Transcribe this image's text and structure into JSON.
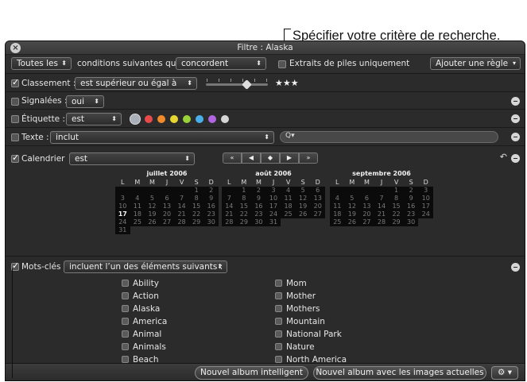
{
  "callout": "Spécifier votre critère de recherche.",
  "window": {
    "title": "Filtre : Alaska"
  },
  "toprow": {
    "scope": "Toutes les",
    "conditions_text": "conditions suivantes qui",
    "match": "concordent",
    "stacks_label": "Extraits de piles uniquement",
    "add_rule": "Ajouter une règle"
  },
  "rating": {
    "label": "Classement :",
    "operator": "est supérieur ou égal à",
    "stars": "★★★"
  },
  "flagged": {
    "label": "Signalées :",
    "value": "oui"
  },
  "label_rule": {
    "label": "Étiquette :",
    "operator": "est",
    "colors": [
      "#e84a4a",
      "#f08a2a",
      "#e8d630",
      "#9ad23a",
      "#4aaee8",
      "#b066e0",
      "#d6d6d6"
    ]
  },
  "text_rule": {
    "label": "Texte :",
    "operator": "inclut",
    "search_prefix": "Q▾"
  },
  "calendar": {
    "label": "Calendrier",
    "operator": "est",
    "nav": [
      "«",
      "◀",
      "◆",
      "▶",
      "»"
    ],
    "day_headers": [
      "L",
      "M",
      "M",
      "J",
      "V",
      "S",
      "D"
    ],
    "months": [
      {
        "title": "juillet 2006",
        "offset": 5,
        "days": 31,
        "highlight": [
          17
        ]
      },
      {
        "title": "août 2006",
        "offset": 1,
        "days": 31,
        "highlight": []
      },
      {
        "title": "septembre 2006",
        "offset": 4,
        "days": 30,
        "highlight": []
      }
    ]
  },
  "keywords": {
    "label": "Mots-clés",
    "operator": "incluent l’un des éléments suivants :",
    "col1": [
      "Ability",
      "Action",
      "Alaska",
      "America",
      "Animal",
      "Animals",
      "Beach"
    ],
    "col2": [
      "Mom",
      "Mother",
      "Mothers",
      "Mountain",
      "National Park",
      "Nature",
      "North America"
    ]
  },
  "bottom": {
    "smart_album": "Nouvel album intelligent",
    "album_current": "Nouvel album avec les images actuelles",
    "gear": "⚙ ▾"
  }
}
